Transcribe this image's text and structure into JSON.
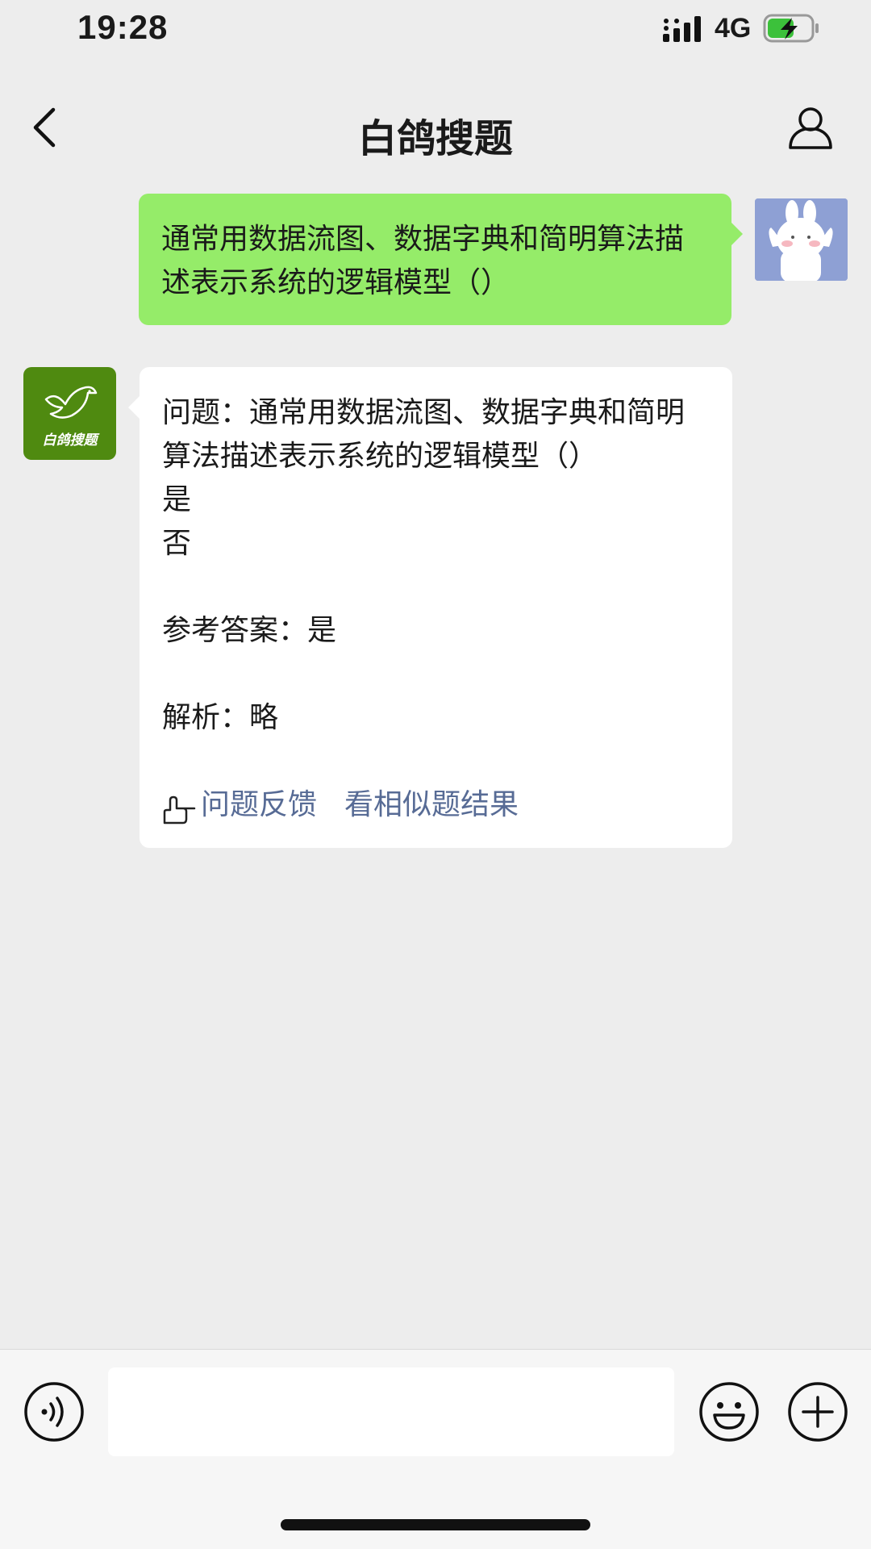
{
  "status_bar": {
    "time": "19:28",
    "network": "4G",
    "icons": [
      "signal-icon",
      "battery-charging-icon"
    ]
  },
  "nav": {
    "title": "白鸽搜题",
    "icons": [
      "back-icon",
      "profile-icon"
    ]
  },
  "messages": {
    "outgoing": {
      "text": "通常用数据流图、数据字典和简明算法描述表示系统的逻辑模型（）",
      "avatar": "bunny-avatar"
    },
    "incoming": {
      "avatar_label": "白鸽搜题",
      "lines": [
        "问题：通常用数据流图、数据字典和简明",
        "算法描述表示系统的逻辑模型（）",
        "是",
        "否",
        "",
        "参考答案：是",
        "",
        "解析：略"
      ],
      "actions": {
        "feedback_label": "问题反馈",
        "similar_label": "看相似题结果"
      },
      "link_color": "#576b95"
    }
  },
  "input_bar": {
    "placeholder": "",
    "icons": [
      "voice-icon",
      "emoji-icon",
      "plus-icon"
    ]
  },
  "colors": {
    "background": "#ededed",
    "outgoing_bubble": "#95ec69",
    "incoming_bubble": "#ffffff",
    "bot_avatar": "#4f8a10",
    "user_avatar_bg": "#8ea0d4"
  }
}
